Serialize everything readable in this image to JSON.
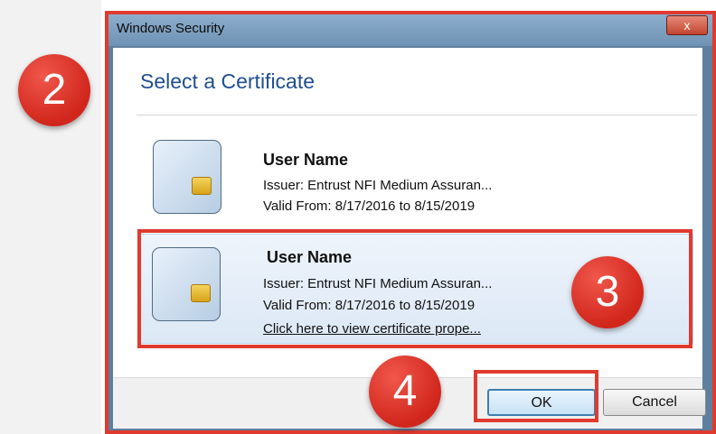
{
  "window": {
    "title": "Windows Security",
    "close_glyph": "x"
  },
  "dialog": {
    "heading": "Select a Certificate",
    "certificates": [
      {
        "name": "User Name",
        "issuer": "Issuer: Entrust NFI Medium Assuran...",
        "valid": "Valid From: 8/17/2016 to 8/15/2019",
        "selected": false
      },
      {
        "name": "User Name",
        "issuer": "Issuer: Entrust NFI Medium Assuran...",
        "valid": "Valid From: 8/17/2016 to 8/15/2019",
        "link": "Click here to view certificate prope...",
        "selected": true
      }
    ],
    "buttons": {
      "ok": "OK",
      "cancel": "Cancel"
    }
  },
  "annotations": {
    "step2": "2",
    "step3": "3",
    "step4": "4",
    "color": "#e03a30"
  },
  "icons": {
    "certificate": "smart-card-icon",
    "close": "close-icon"
  }
}
